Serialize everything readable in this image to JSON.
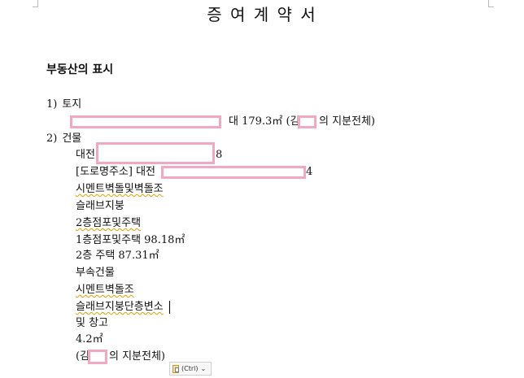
{
  "document": {
    "title": "증 여 계 약 서",
    "section_heading": "부동산의 표시",
    "items": {
      "land": {
        "number": "1)",
        "label": "토지",
        "detail": "대 179.3㎡ (김",
        "detail_end": "의 지분전체)"
      },
      "building": {
        "number": "2)",
        "label": "건물",
        "address_prefix": "대전",
        "address_suffix": "8",
        "road_address_prefix": "[도로명주소] 대전",
        "road_address_suffix": "4",
        "structure": "시멘트벽돌및벽돌조",
        "roof": "슬래브지붕",
        "floors": "2층점포및주택",
        "floor1": "1층점포및주택 98.18㎡",
        "floor2": "2층 주택 87.31㎡",
        "annex_heading": "부속건물",
        "annex_structure": "시멘트벽돌조",
        "annex_roof": "슬래브지붕단층변소",
        "annex_use": "및 창고",
        "annex_area": "4.2㎡",
        "share_prefix": "(김",
        "share_suffix": "의 지분전체)"
      }
    }
  },
  "paste_options": {
    "label": "(Ctrl)",
    "icon": "clipboard-icon",
    "arrow_icon": "chevron-down-icon"
  }
}
